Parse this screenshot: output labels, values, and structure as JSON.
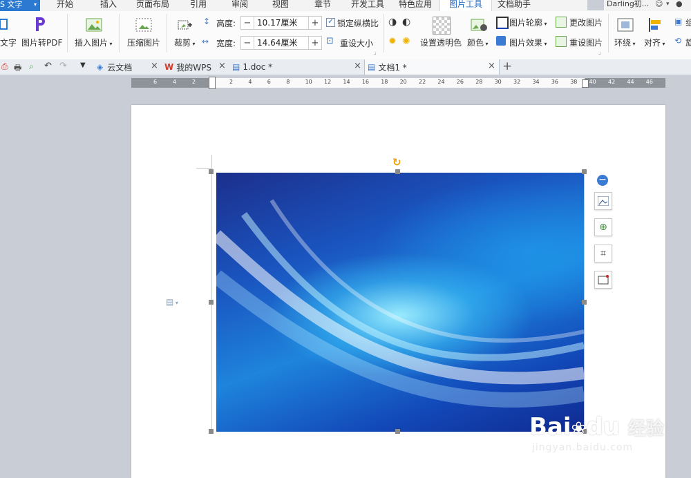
{
  "menubar": {
    "app_label": "S 文字",
    "app_arrow": "▾",
    "tabs": [
      "开始",
      "插入",
      "页面布局",
      "引用",
      "审阅",
      "视图",
      "章节",
      "开发工具",
      "特色应用",
      "图片工具",
      "文档助手"
    ],
    "active_tab": "图片工具",
    "user_name": "Darling初..."
  },
  "ribbon": {
    "to_text_label": "文字",
    "pic_to_pdf_label": "图片转PDF",
    "insert_picture_label": "插入图片",
    "compress_picture_label": "压缩图片",
    "crop_label": "裁剪",
    "height_label": "高度:",
    "height_value": "10.17厘米",
    "width_label": "宽度:",
    "width_value": "14.64厘米",
    "lock_ratio_label": "锁定纵横比",
    "resize_label": "重设大小",
    "set_transparent_label": "设置透明色",
    "color_label": "颜色",
    "picture_outline_label": "图片轮廓",
    "picture_effect_label": "图片效果",
    "change_picture_label": "更改图片",
    "reset_picture_label": "重设图片",
    "wrap_label": "环绕",
    "align_label": "对齐",
    "extra_label": "旋",
    "extra_label2": "组"
  },
  "tabs": [
    {
      "label": "云文档"
    },
    {
      "label": "我的WPS"
    },
    {
      "label": "1.doc *"
    },
    {
      "label": "文档1 *"
    }
  ],
  "ruler": {
    "left_numbers": [
      "6",
      "4",
      "2"
    ],
    "right_numbers": [
      "2",
      "4",
      "6",
      "8",
      "10",
      "12",
      "14",
      "16",
      "18",
      "20",
      "22",
      "24",
      "26",
      "28",
      "30",
      "32",
      "34",
      "36",
      "38",
      "40",
      "42",
      "44",
      "46"
    ]
  },
  "watermark": {
    "brand": "Bai",
    "brand2": "du",
    "cn": "经验",
    "url": "jingyan.baidu.com"
  },
  "colors": {
    "accent": "#2b79d0",
    "active_tab_text": "#2b6fc3",
    "ruler_gray": "#8e939a",
    "workspace": "#c9cdd5"
  }
}
